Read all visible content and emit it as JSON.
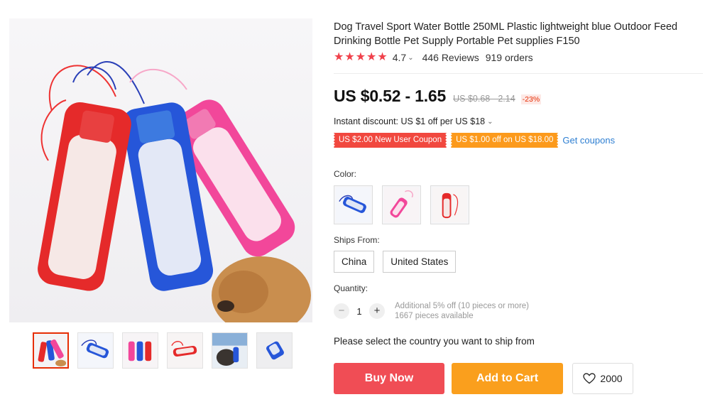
{
  "product": {
    "title": "Dog Travel Sport Water Bottle 250ML Plastic lightweight blue Outdoor Feed Drinking Bottle Pet Supply Portable Pet supplies F150",
    "rating": "4.7",
    "rating_stars": 5,
    "reviews": "446 Reviews",
    "orders": "919 orders"
  },
  "pricing": {
    "price": "US $0.52 - 1.65",
    "original_price": "US $0.68 - 2.14",
    "discount": "-23%",
    "instant_discount": "Instant discount: US $1 off per US $18"
  },
  "coupons": {
    "new_user": "US $2.00 New User Coupon",
    "store": "US $1.00 off on US $18.00",
    "get_link": "Get coupons"
  },
  "color": {
    "label": "Color:",
    "options": [
      "blue",
      "pink",
      "red"
    ]
  },
  "shipping": {
    "label": "Ships From:",
    "options": [
      "China",
      "United States"
    ],
    "message": "Please select the country you want to ship from"
  },
  "quantity": {
    "label": "Quantity:",
    "value": "1",
    "minus": "−",
    "plus": "+",
    "note1": "Additional 5% off (10 pieces or more)",
    "note2": "1667 pieces available"
  },
  "actions": {
    "buy_now": "Buy Now",
    "add_to_cart": "Add to Cart",
    "wishlist_count": "2000"
  },
  "icons": {
    "star": "star-icon",
    "chevron": "chevron-down-icon",
    "heart": "heart-icon"
  },
  "colors": {
    "accent_red": "#f04d55",
    "accent_orange": "#fa9f1d",
    "link_blue": "#2e7fd2",
    "star_red": "#f0414b"
  }
}
